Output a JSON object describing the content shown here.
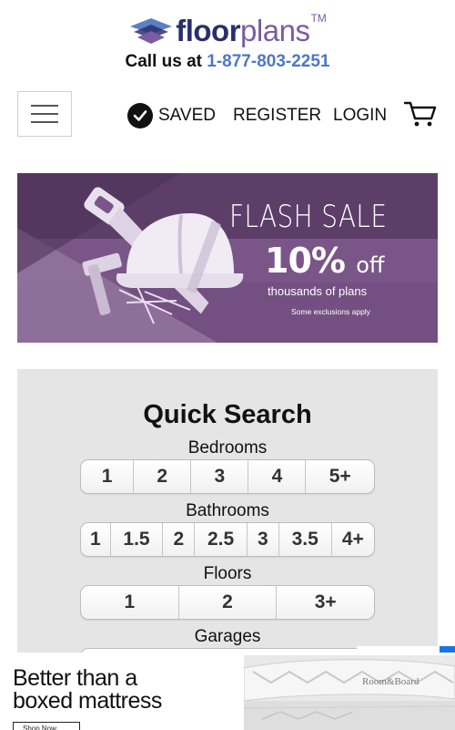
{
  "header": {
    "logo": {
      "brand_bold": "floor",
      "brand_light": "plans",
      "trademark": "TM",
      "icon": "layers-logo-icon"
    },
    "call_prefix": "Call us at",
    "phone": "1-877-803-2251"
  },
  "nav": {
    "menu_icon": "hamburger-icon",
    "saved_label": "SAVED",
    "saved_icon": "check-circle-icon",
    "register_label": "REGISTER",
    "login_label": "LOGIN",
    "cart_icon": "shopping-cart-icon"
  },
  "banner": {
    "title": "FLASH SALE",
    "discount": "10%",
    "discount_suffix": "off",
    "subtitle": "thousands of plans",
    "note": "Some exclusions apply",
    "colors": {
      "dark": "#5d3e69",
      "mid": "#7a5688",
      "light": "#93749f"
    }
  },
  "quick_search": {
    "title": "Quick Search",
    "bedrooms": {
      "label": "Bedrooms",
      "options": [
        "1",
        "2",
        "3",
        "4",
        "5+"
      ]
    },
    "bathrooms": {
      "label": "Bathrooms",
      "options": [
        "1",
        "1.5",
        "2",
        "2.5",
        "3",
        "3.5",
        "4+"
      ]
    },
    "floors": {
      "label": "Floors",
      "options": [
        "1",
        "2",
        "3+"
      ]
    },
    "garages": {
      "label": "Garages"
    }
  },
  "ad": {
    "headline_line1": "Better than a",
    "headline_line2": "boxed mattress",
    "button_label": "Shop Now",
    "image_label": "Room&Board"
  },
  "colors": {
    "brand_navy": "#2a2f6b",
    "brand_purple": "#7c5ba3",
    "phone_blue": "#4d78c4",
    "panel_gray": "#e5e5e5"
  }
}
